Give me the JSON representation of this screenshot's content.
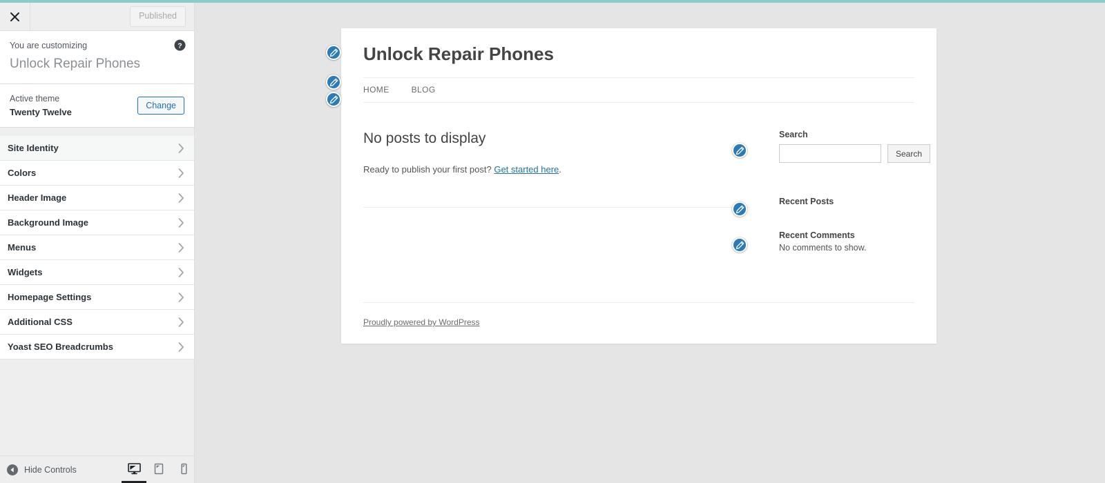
{
  "theme_colors": {
    "accent_teal": "#8ccacb",
    "link_blue": "#21759b",
    "wp_blue": "#2271b1",
    "pencil_blue": "#2c7bb6"
  },
  "customizer": {
    "close_icon": "close-x-icon",
    "publish_button": "Published",
    "help_icon": "help-question-icon",
    "customizing_label": "You are customizing",
    "site_title": "Unlock Repair Phones",
    "theme": {
      "label": "Active theme",
      "name": "Twenty Twelve",
      "change_button": "Change"
    },
    "sections": [
      {
        "label": "Site Identity",
        "hovered": true
      },
      {
        "label": "Colors",
        "hovered": false
      },
      {
        "label": "Header Image",
        "hovered": false
      },
      {
        "label": "Background Image",
        "hovered": false
      },
      {
        "label": "Menus",
        "hovered": false
      },
      {
        "label": "Widgets",
        "hovered": false
      },
      {
        "label": "Homepage Settings",
        "hovered": false
      },
      {
        "label": "Additional CSS",
        "hovered": false
      },
      {
        "label": "Yoast SEO Breadcrumbs",
        "hovered": false
      }
    ],
    "footer": {
      "hide_controls_label": "Hide Controls",
      "collapse_icon": "collapse-left-arrow-icon",
      "devices": [
        {
          "name": "desktop",
          "icon": "desktop-monitor-icon",
          "active": true
        },
        {
          "name": "tablet",
          "icon": "tablet-icon",
          "active": false
        },
        {
          "name": "mobile",
          "icon": "mobile-phone-icon",
          "active": false
        }
      ]
    }
  },
  "preview": {
    "site_title": "Unlock Repair Phones",
    "nav": [
      {
        "label": "HOME"
      },
      {
        "label": "BLOG"
      }
    ],
    "content": {
      "heading": "No posts to display",
      "prompt_prefix": "Ready to publish your first post? ",
      "prompt_link": "Get started here",
      "prompt_suffix": "."
    },
    "widgets": {
      "search": {
        "title": "Search",
        "input_value": "",
        "input_placeholder": "",
        "submit_label": "Search"
      },
      "recent_posts": {
        "title": "Recent Posts",
        "body": ""
      },
      "recent_comments": {
        "title": "Recent Comments",
        "body": "No comments to show."
      }
    },
    "footer_link": "Proudly powered by WordPress",
    "edit_shortcuts": [
      {
        "name": "site-title",
        "icon": "edit-pencil-icon"
      },
      {
        "name": "header-image",
        "icon": "edit-pencil-icon"
      },
      {
        "name": "nav-menu",
        "icon": "edit-pencil-icon"
      },
      {
        "name": "search-widget",
        "icon": "edit-pencil-icon"
      },
      {
        "name": "recent-posts-widget",
        "icon": "edit-pencil-icon"
      },
      {
        "name": "recent-comments-widget",
        "icon": "edit-pencil-icon"
      }
    ]
  }
}
